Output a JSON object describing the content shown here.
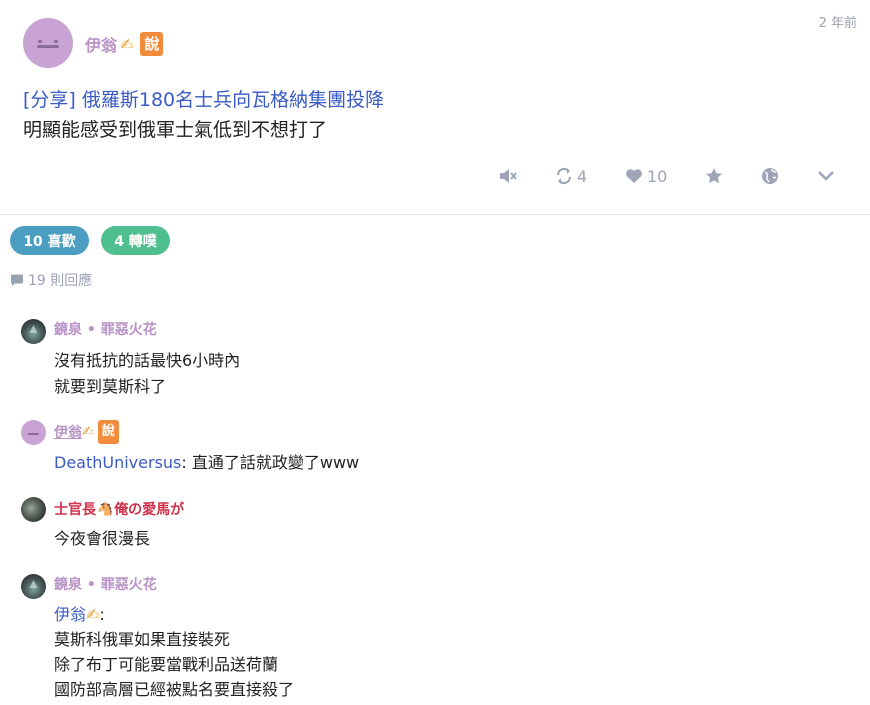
{
  "post": {
    "author": "伊翁",
    "author_emoji": "✍",
    "author_badge": "說",
    "time": "2 年前",
    "title": "[分享] 俄羅斯180名士兵向瓦格納集團投降",
    "body": "明顯能感受到俄軍士氣低到不想打了",
    "reblog_count": "4",
    "like_count": "10"
  },
  "colors": {
    "accent": "#3b5bc6",
    "name_purple": "#b892c4",
    "name_red": "#d0304a",
    "badge": "#f28c3c",
    "likes_pill": "#4b9ec0",
    "reblogs_pill": "#4fbf8f",
    "muted": "#9ea5b8"
  },
  "stats": {
    "likes_label": "10 喜歡",
    "reblogs_label": "4 轉噗",
    "replies_label": "19 則回應"
  },
  "comments": [
    {
      "name": "鏡泉 • 罪惡火花",
      "lines": [
        "沒有抵抗的話最快6小時內",
        "就要到莫斯科了"
      ]
    },
    {
      "name": "伊翁",
      "emoji": "✍",
      "badge": "說",
      "mention": "DeathUniversus",
      "text": ": 直通了話就政變了www"
    },
    {
      "name_a": "士官長",
      "horse": "🐴",
      "name_b": "俺の愛馬が",
      "lines": [
        "今夜會很漫長"
      ]
    },
    {
      "name": "鏡泉 • 罪惡火花",
      "mention": "伊翁",
      "emoji": "✍",
      "suffix": ":",
      "lines": [
        "莫斯科俄軍如果直接裝死",
        "除了布丁可能要當戰利品送荷蘭",
        "國防部高層已經被點名要直接殺了"
      ]
    }
  ],
  "icons": [
    "mute-icon",
    "reblog-icon",
    "heart-icon",
    "star-icon",
    "globe-icon",
    "chevron-down-icon",
    "comment-icon"
  ]
}
